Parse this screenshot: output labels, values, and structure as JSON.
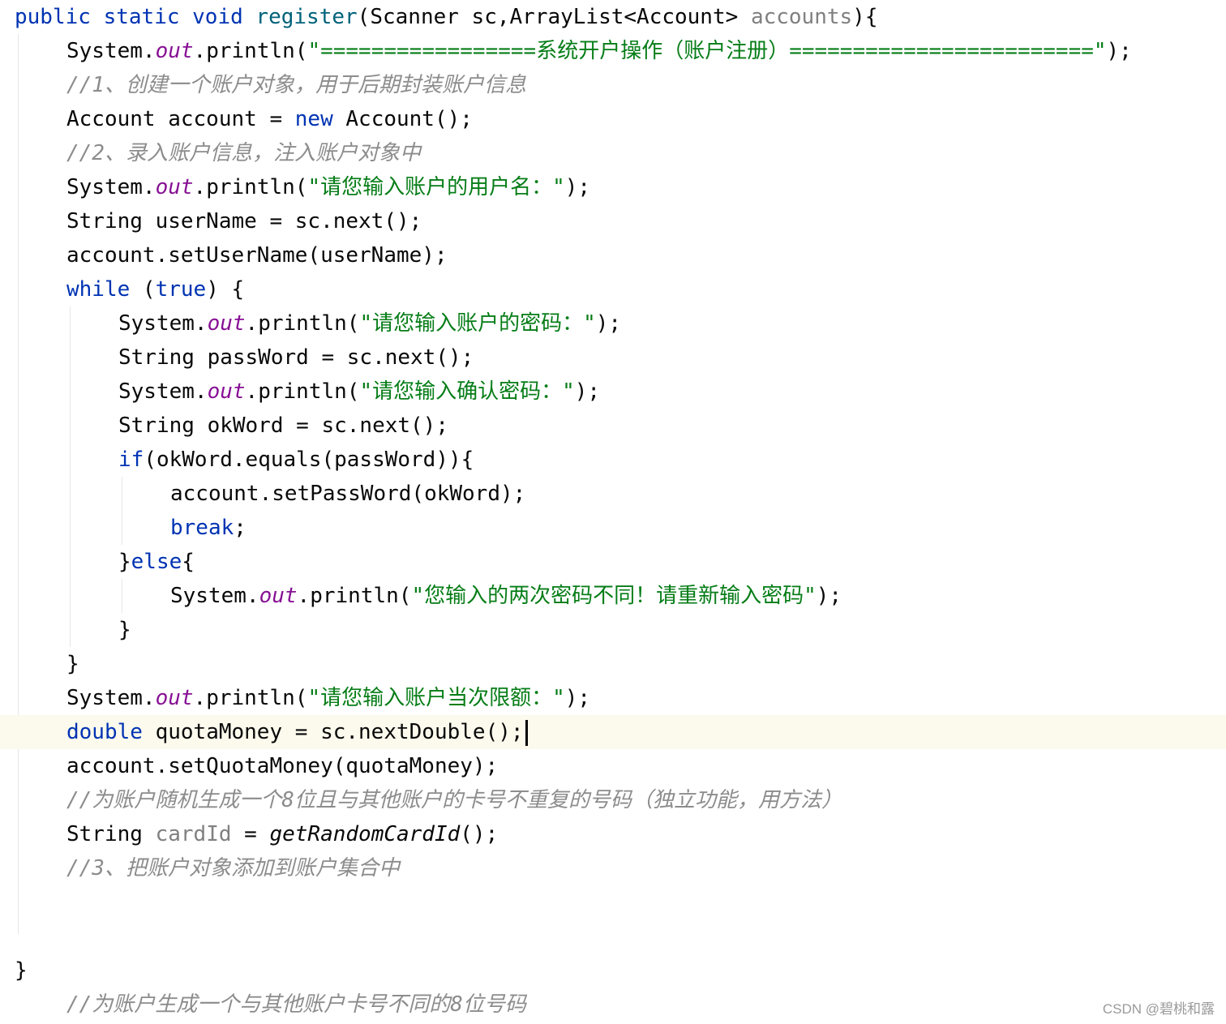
{
  "editor": {
    "current_line_index": 21,
    "lines": [
      {
        "indent": 0,
        "tokens": [
          [
            "kw",
            "public "
          ],
          [
            "kw",
            "static "
          ],
          [
            "kw",
            "void "
          ],
          [
            "method",
            "register"
          ],
          [
            "plain",
            "(Scanner sc,ArrayList<Account> "
          ],
          [
            "unused",
            "accounts"
          ],
          [
            "plain",
            "){"
          ]
        ]
      },
      {
        "indent": 1,
        "tokens": [
          [
            "plain",
            "System."
          ],
          [
            "field",
            "out"
          ],
          [
            "plain",
            ".println("
          ],
          [
            "str",
            "\"=================系统开户操作（账户注册）========================\""
          ],
          [
            "plain",
            ");"
          ]
        ]
      },
      {
        "indent": 1,
        "tokens": [
          [
            "comment",
            "//1、创建一个账户对象，用于后期封装账户信息"
          ]
        ]
      },
      {
        "indent": 1,
        "tokens": [
          [
            "plain",
            "Account account = "
          ],
          [
            "kw",
            "new "
          ],
          [
            "plain",
            "Account();"
          ]
        ]
      },
      {
        "indent": 1,
        "tokens": [
          [
            "comment",
            "//2、录入账户信息，注入账户对象中"
          ]
        ]
      },
      {
        "indent": 1,
        "tokens": [
          [
            "plain",
            "System."
          ],
          [
            "field",
            "out"
          ],
          [
            "plain",
            ".println("
          ],
          [
            "str",
            "\"请您输入账户的用户名：\""
          ],
          [
            "plain",
            ");"
          ]
        ]
      },
      {
        "indent": 1,
        "tokens": [
          [
            "plain",
            "String userName = sc.next();"
          ]
        ]
      },
      {
        "indent": 1,
        "tokens": [
          [
            "plain",
            "account.setUserName(userName);"
          ]
        ]
      },
      {
        "indent": 1,
        "tokens": [
          [
            "kw",
            "while "
          ],
          [
            "plain",
            "("
          ],
          [
            "kw",
            "true"
          ],
          [
            "plain",
            ") {"
          ]
        ]
      },
      {
        "indent": 2,
        "tokens": [
          [
            "plain",
            "System."
          ],
          [
            "field",
            "out"
          ],
          [
            "plain",
            ".println("
          ],
          [
            "str",
            "\"请您输入账户的密码：\""
          ],
          [
            "plain",
            ");"
          ]
        ]
      },
      {
        "indent": 2,
        "tokens": [
          [
            "plain",
            "String passWord = sc.next();"
          ]
        ]
      },
      {
        "indent": 2,
        "tokens": [
          [
            "plain",
            "System."
          ],
          [
            "field",
            "out"
          ],
          [
            "plain",
            ".println("
          ],
          [
            "str",
            "\"请您输入确认密码：\""
          ],
          [
            "plain",
            ");"
          ]
        ]
      },
      {
        "indent": 2,
        "tokens": [
          [
            "plain",
            "String okWord = sc.next();"
          ]
        ]
      },
      {
        "indent": 2,
        "tokens": [
          [
            "kw",
            "if"
          ],
          [
            "plain",
            "(okWord.equals(passWord)){"
          ]
        ]
      },
      {
        "indent": 3,
        "tokens": [
          [
            "plain",
            "account.setPassWord(okWord);"
          ]
        ]
      },
      {
        "indent": 3,
        "tokens": [
          [
            "kw",
            "break"
          ],
          [
            "plain",
            ";"
          ]
        ]
      },
      {
        "indent": 2,
        "tokens": [
          [
            "plain",
            "}"
          ],
          [
            "kw",
            "else"
          ],
          [
            "plain",
            "{"
          ]
        ]
      },
      {
        "indent": 3,
        "tokens": [
          [
            "plain",
            "System."
          ],
          [
            "field",
            "out"
          ],
          [
            "plain",
            ".println("
          ],
          [
            "str",
            "\"您输入的两次密码不同！请重新输入密码\""
          ],
          [
            "plain",
            ");"
          ]
        ]
      },
      {
        "indent": 2,
        "tokens": [
          [
            "plain",
            "}"
          ]
        ]
      },
      {
        "indent": 1,
        "tokens": [
          [
            "plain",
            "}"
          ]
        ]
      },
      {
        "indent": 1,
        "tokens": [
          [
            "plain",
            "System."
          ],
          [
            "field",
            "out"
          ],
          [
            "plain",
            ".println("
          ],
          [
            "str",
            "\"请您输入账户当次限额：\""
          ],
          [
            "plain",
            ");"
          ]
        ]
      },
      {
        "indent": 1,
        "tokens": [
          [
            "kw",
            "double "
          ],
          [
            "plain",
            "quotaMoney = sc.nextDouble();"
          ]
        ],
        "caret": true
      },
      {
        "indent": 1,
        "tokens": [
          [
            "plain",
            "account.setQuotaMoney(quotaMoney);"
          ]
        ]
      },
      {
        "indent": 1,
        "tokens": [
          [
            "comment",
            "//为账户随机生成一个8位且与其他账户的卡号不重复的号码（独立功能，用方法）"
          ]
        ]
      },
      {
        "indent": 1,
        "tokens": [
          [
            "plain",
            "String "
          ],
          [
            "unused",
            "cardId"
          ],
          [
            "plain",
            " = "
          ],
          [
            "static-call",
            "getRandomCardId"
          ],
          [
            "plain",
            "();"
          ]
        ]
      },
      {
        "indent": 1,
        "tokens": [
          [
            "comment",
            "//3、把账户对象添加到账户集合中"
          ]
        ]
      },
      {
        "indent": 0,
        "tokens": []
      },
      {
        "indent": 0,
        "tokens": []
      },
      {
        "indent": 0,
        "tokens": [
          [
            "plain",
            "}"
          ]
        ]
      },
      {
        "indent": 1,
        "tokens": [
          [
            "comment",
            "//为账户生成一个与其他账户卡号不同的8位号码"
          ]
        ]
      }
    ]
  },
  "watermark": "CSDN @碧桃和露"
}
